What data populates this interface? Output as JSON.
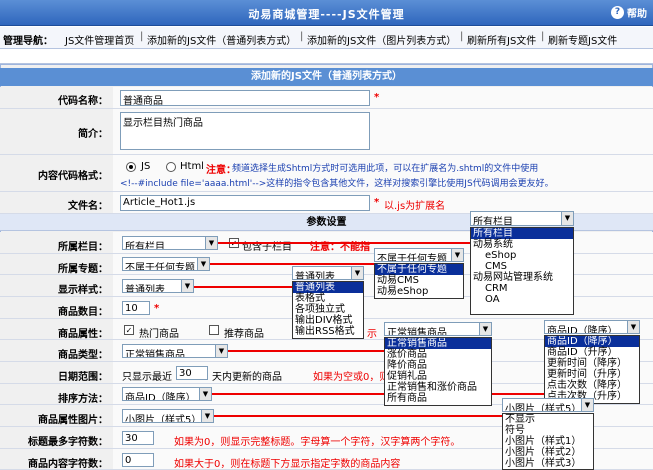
{
  "title": "动易商城管理----JS文件管理",
  "help": "帮助",
  "nav": {
    "label": "管理导航：",
    "links": [
      "JS文件管理首页",
      "添加新的JS文件（普通列表方式）",
      "添加新的JS文件（图片列表方式）",
      "刷新所有JS文件",
      "刷新专题JS文件"
    ]
  },
  "section_title": "添加新的JS文件（普通列表方式）",
  "fields": {
    "name": {
      "label": "代码名称：",
      "value": "普通商品"
    },
    "intro": {
      "label": "简介：",
      "value": "显示栏目热门商品"
    },
    "format": {
      "label": "内容代码格式：",
      "opt_js": "JS",
      "opt_html": "Html",
      "note_red": "注意：",
      "note_blue": "频道选择生成Shtml方式时可选用此项，可以在扩展名为.shtml的文件中使用",
      "note_line2": "<!--#include file='aaaa.html'-->这样的指令包含其他文件，这样对搜索引擎比使用JS代码调用会更友好。"
    },
    "filename": {
      "label": "文件名：",
      "value": "Article_Hot1.js",
      "hint": "以.js为扩展名"
    }
  },
  "param_header": "参数设置",
  "params": {
    "column": {
      "label": "所属栏目：",
      "value": "所有栏目",
      "checkbox": "包含子栏目",
      "note": "注意：不能指"
    },
    "special": {
      "label": "所属专题：",
      "value": "不属于任何专题"
    },
    "style": {
      "label": "显示样式：",
      "value": "普通列表"
    },
    "count": {
      "label": "商品数目：",
      "value": "10"
    },
    "attr": {
      "label": "商品属性：",
      "opt1": "热门商品",
      "opt2": "推荐商品",
      "suffix": "示"
    },
    "type": {
      "label": "商品类型：",
      "value": "正常销售商品"
    },
    "date": {
      "label": "日期范围：",
      "prefix": "只显示最近",
      "value": "30",
      "suffix": "天内更新的商品",
      "hint": "如果为空或0，则"
    },
    "order": {
      "label": "排序方法：",
      "value": "商品ID（降序）"
    },
    "pic": {
      "label": "商品属性图片：",
      "value": "小图片（样式5）"
    },
    "title_len": {
      "label": "标题最多字符数：",
      "value": "30",
      "hint": "如果为0，则显示完整标题。字母算一个字符，汉字算两个字符。"
    },
    "content_len": {
      "label": "商品内容字符数：",
      "value": "0",
      "hint": "如果大于0，则在标题下方显示指定字数的商品内容"
    }
  },
  "dropdowns": {
    "column_top": "所有栏目",
    "column_items": [
      "所有栏目",
      "动易系统",
      "eShop",
      "CMS",
      "动易网站管理系统",
      "CRM",
      "OA"
    ],
    "special_top": "不属于任何专题",
    "special_items": [
      "不属于任何专题",
      "动易CMS",
      "动易eShop"
    ],
    "style_top": "普通列表",
    "style_items": [
      "普通列表",
      "表格式",
      "各项独立式",
      "输出DIV格式",
      "输出RSS格式"
    ],
    "type_top": "正常销售商品",
    "type_items": [
      "正常销售商品",
      "涨价商品",
      "降价商品",
      "促销礼品",
      "正常销售和涨价商品",
      "所有商品"
    ],
    "order_top": "商品ID（降序）",
    "order_items": [
      "商品ID（降序）",
      "商品ID（升序）",
      "更新时间（降序）",
      "更新时间（升序）",
      "点击次数（降序）",
      "点击次数（升序）"
    ],
    "pic_top": "小图片（样式5）",
    "pic_items": [
      "不显示",
      "符号",
      "小图片（样式1）",
      "小图片（样式2）",
      "小图片（样式3）"
    ]
  },
  "colors": {
    "titlebar": "#2f66bd",
    "section": "#5a8fd4",
    "accent": "#e00000",
    "note": "#1a3fb0",
    "selected": "#0a2f9a"
  }
}
